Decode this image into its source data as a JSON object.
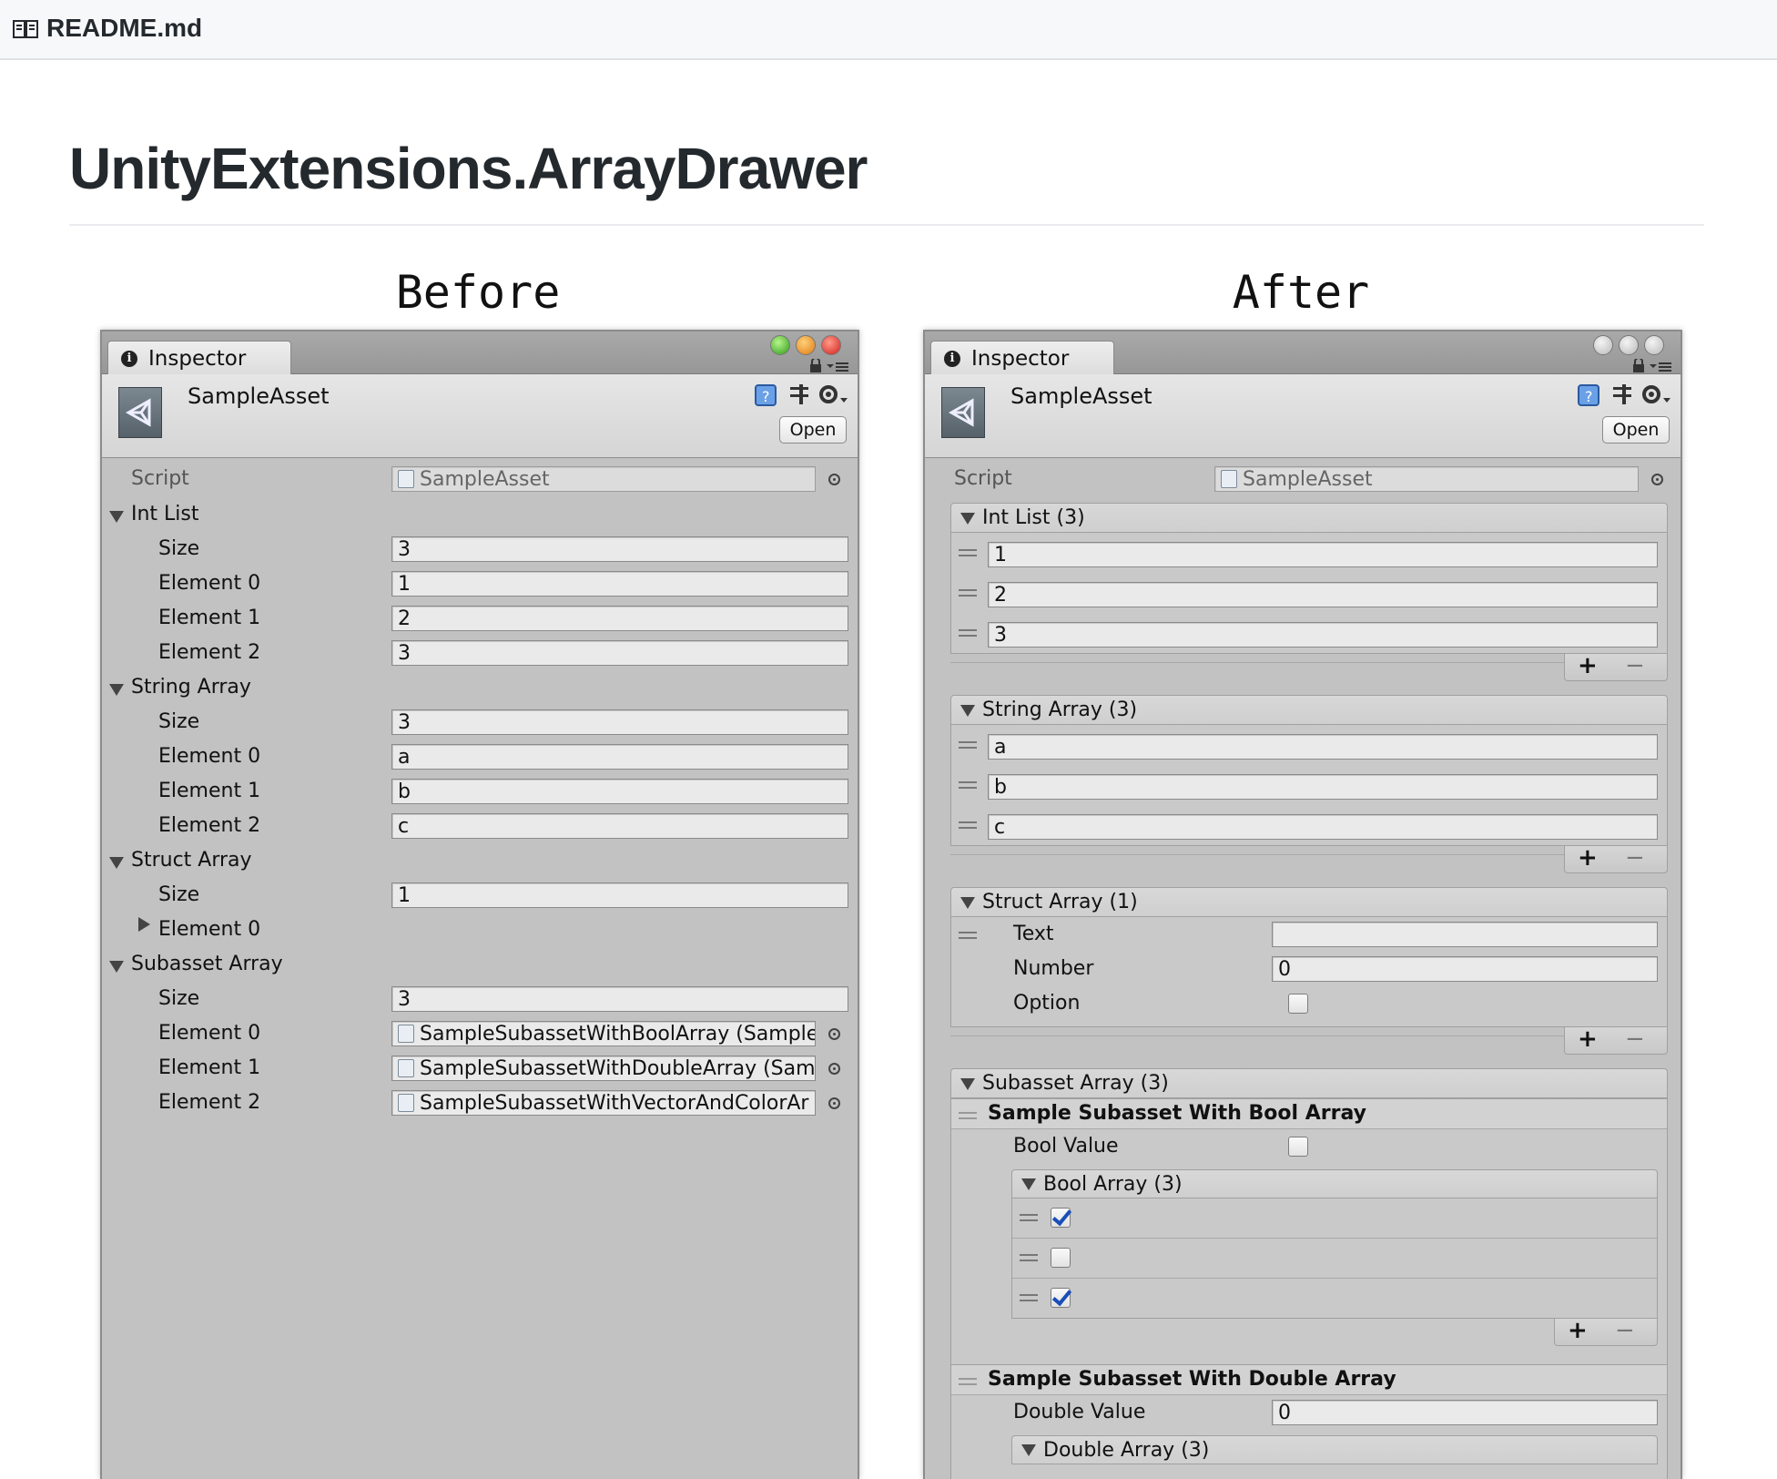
{
  "file": {
    "name": "README.md",
    "icon": "book-icon"
  },
  "title": "UnityExtensions.ArrayDrawer",
  "captions": {
    "before": "Before",
    "after": "After"
  },
  "inspector": {
    "tab_label": "Inspector",
    "asset_name": "SampleAsset",
    "open_label": "Open",
    "script_label": "Script",
    "script_value": "SampleAsset"
  },
  "before": {
    "size_label": "Size",
    "int_list": {
      "label": "Int List",
      "size": "3",
      "elements": [
        {
          "label": "Element 0",
          "value": "1"
        },
        {
          "label": "Element 1",
          "value": "2"
        },
        {
          "label": "Element 2",
          "value": "3"
        }
      ]
    },
    "string_array": {
      "label": "String Array",
      "size": "3",
      "elements": [
        {
          "label": "Element 0",
          "value": "a"
        },
        {
          "label": "Element 1",
          "value": "b"
        },
        {
          "label": "Element 2",
          "value": "c"
        }
      ]
    },
    "struct_array": {
      "label": "Struct Array",
      "size": "1",
      "element0": "Element 0"
    },
    "subasset_array": {
      "label": "Subasset Array",
      "size": "3",
      "elements": [
        {
          "label": "Element 0",
          "value": "SampleSubassetWithBoolArray (Sample"
        },
        {
          "label": "Element 1",
          "value": "SampleSubassetWithDoubleArray (Sam"
        },
        {
          "label": "Element 2",
          "value": "SampleSubassetWithVectorAndColorAr"
        }
      ]
    }
  },
  "after": {
    "int_list": {
      "header": "Int List (3)",
      "values": [
        "1",
        "2",
        "3"
      ]
    },
    "string_array": {
      "header": "String Array (3)",
      "values": [
        "a",
        "b",
        "c"
      ]
    },
    "struct_array": {
      "header": "Struct Array (1)",
      "text_label": "Text",
      "text_value": "",
      "number_label": "Number",
      "number_value": "0",
      "option_label": "Option",
      "option_checked": false
    },
    "subasset_array": {
      "header": "Subasset Array (3)",
      "item1": {
        "title": "Sample Subasset With Bool Array",
        "bool_value_label": "Bool Value",
        "bool_value": false,
        "bool_array_header": "Bool Array (3)",
        "bool_array": [
          true,
          false,
          true
        ]
      },
      "item2": {
        "title": "Sample Subasset With Double Array",
        "double_value_label": "Double Value",
        "double_value": "0",
        "double_array_header": "Double Array (3)"
      }
    },
    "plus": "+",
    "minus": "−"
  }
}
